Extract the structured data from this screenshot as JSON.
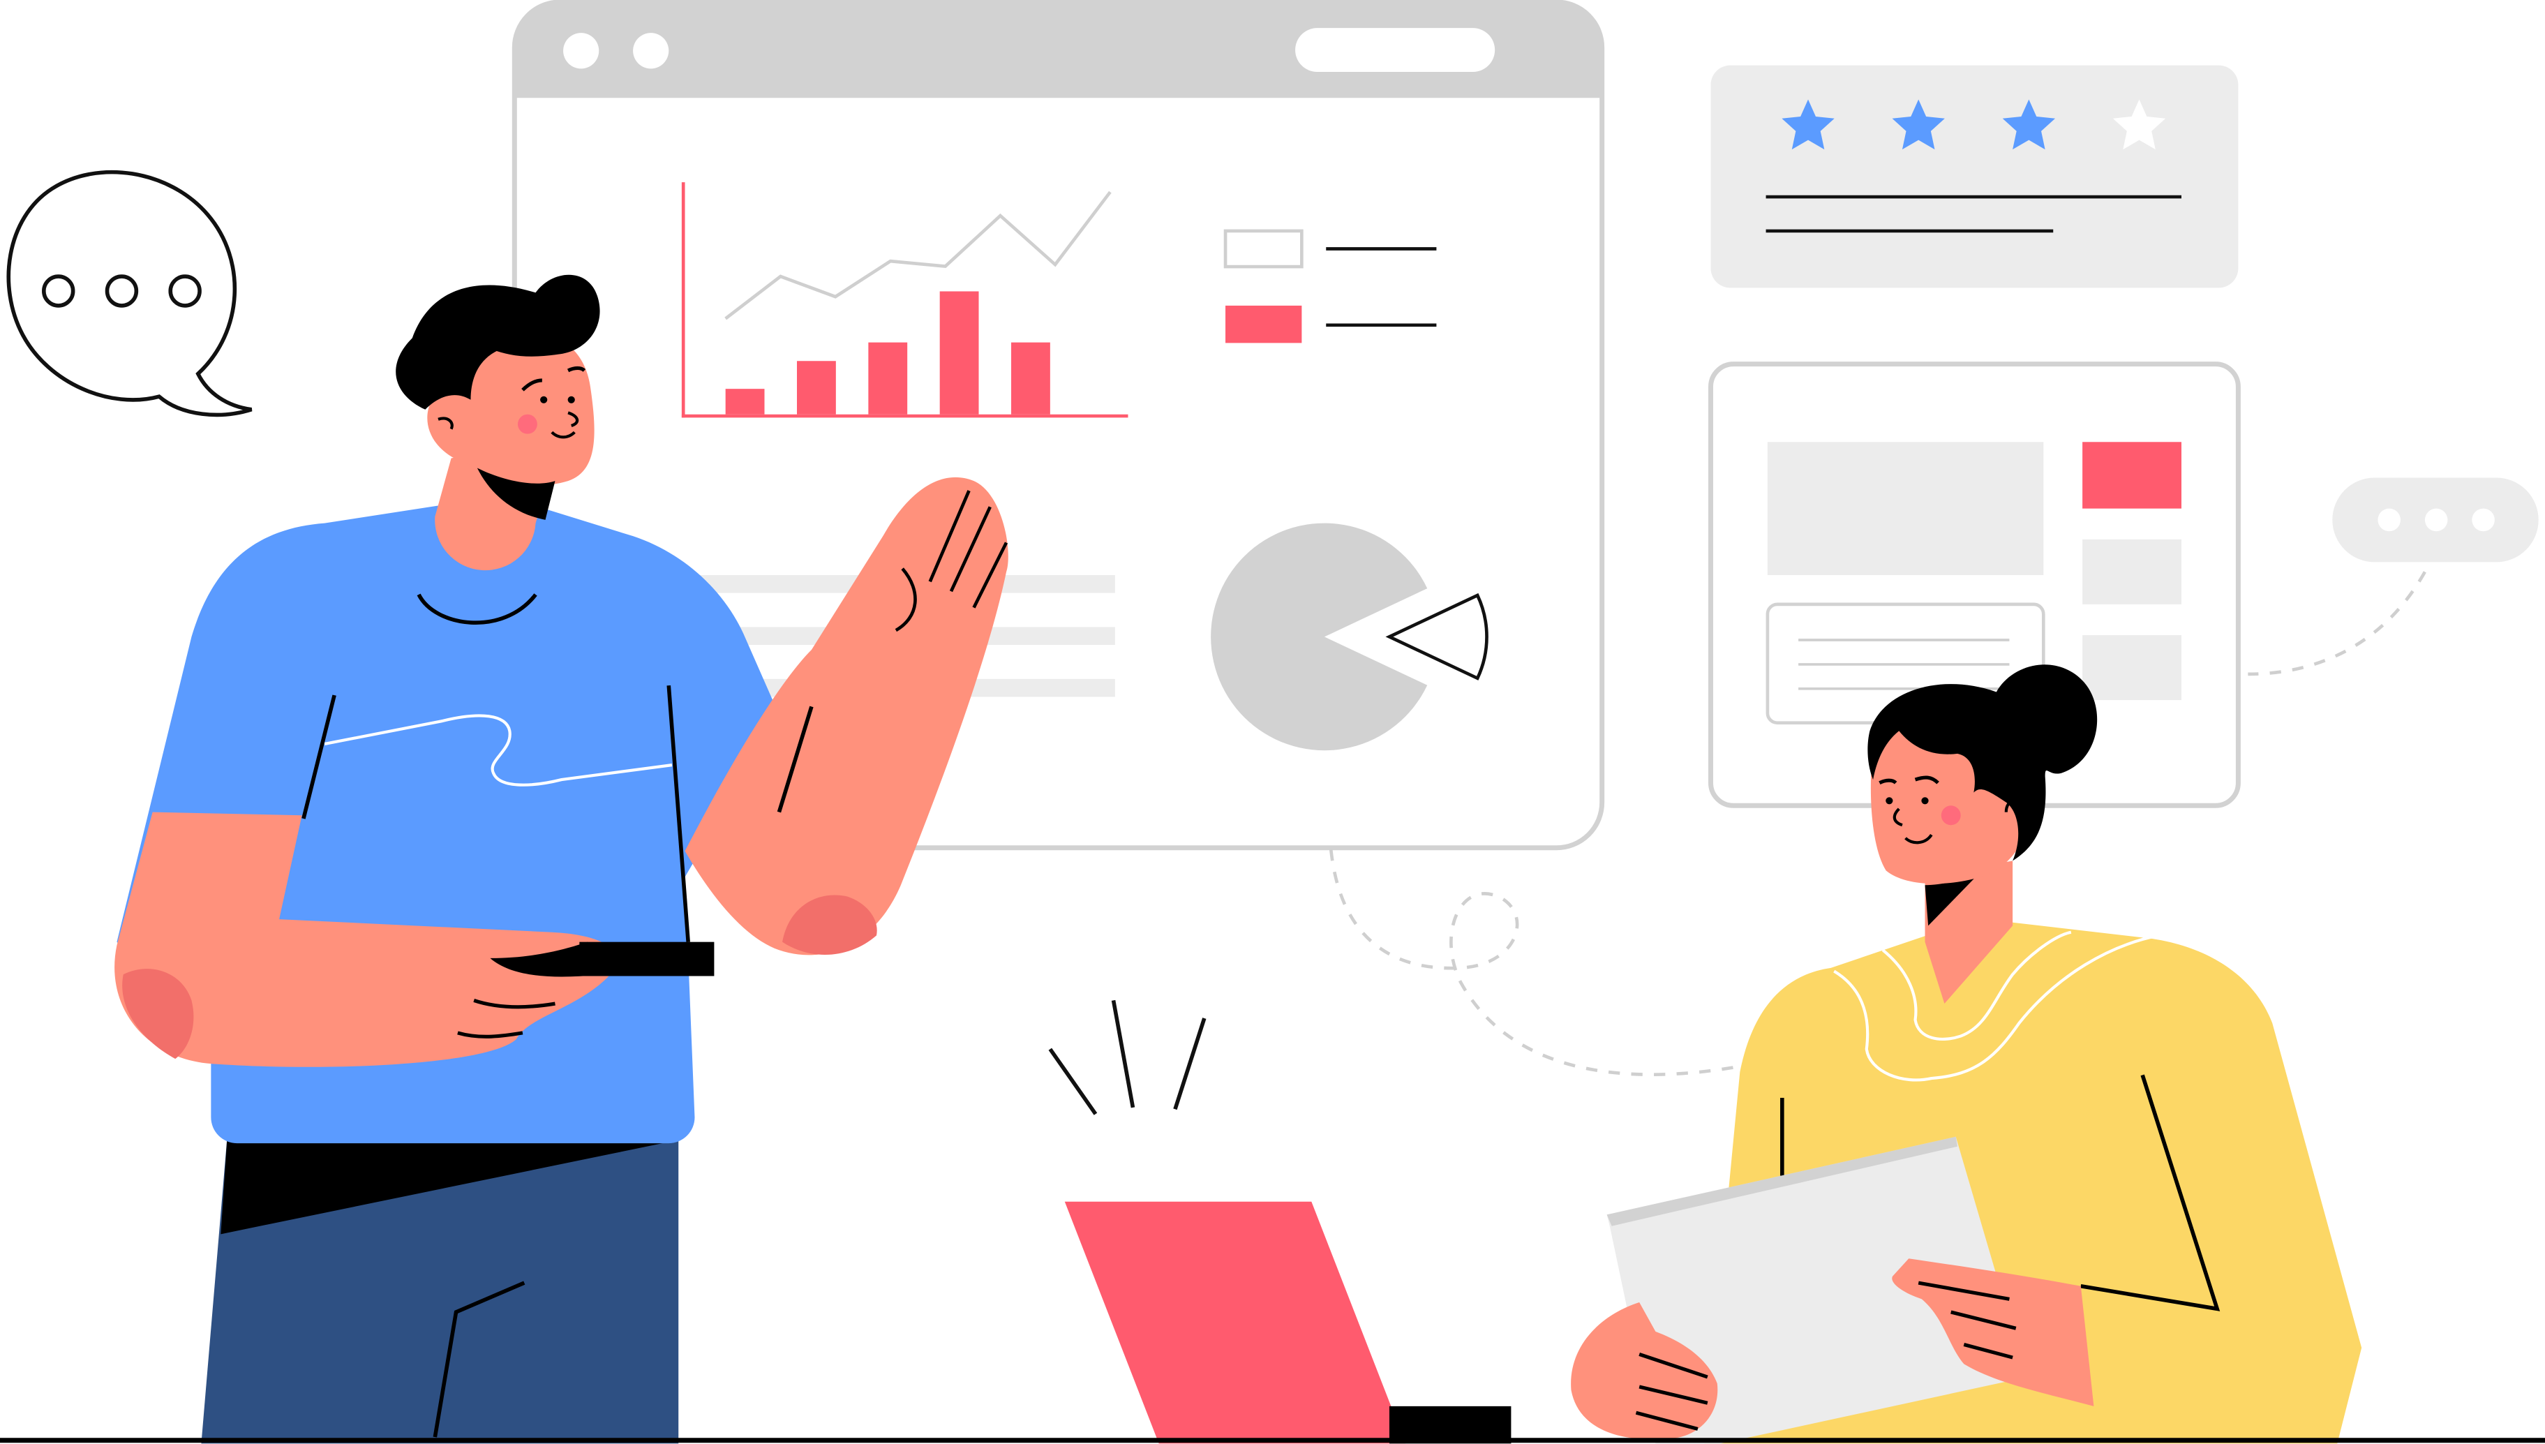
{
  "palette": {
    "background": "#ffffff",
    "panel_gray": "#d2d2d2",
    "panel_light": "#ececec",
    "outline_gray": "#cfcfcf",
    "accent_red": "#ff5b6e",
    "star_blue": "#5b9bff",
    "shirt_blue": "#5b9bff",
    "pants_navy": "#2e5083",
    "skin": "#ff917c",
    "skin_dark": "#f26f6a",
    "hair": "#000000",
    "shirt_yellow": "#fcd766",
    "line_black": "#111111"
  },
  "rating": {
    "filled_stars": 3,
    "total_stars": 4
  },
  "dashboard_chart": {
    "bars": [
      0.11,
      0.23,
      0.31,
      0.53,
      0.31
    ],
    "line": [
      0.25,
      0.5,
      0.38,
      0.59,
      0.56,
      0.86,
      0.57,
      1.0
    ]
  },
  "pie_chart": {
    "removed_slice_fraction": 0.14
  },
  "icons": {
    "speech_bubble_left": "chat-bubble-icon",
    "speech_bubble_right": "typing-bubble-icon",
    "stars": "star-icon"
  }
}
